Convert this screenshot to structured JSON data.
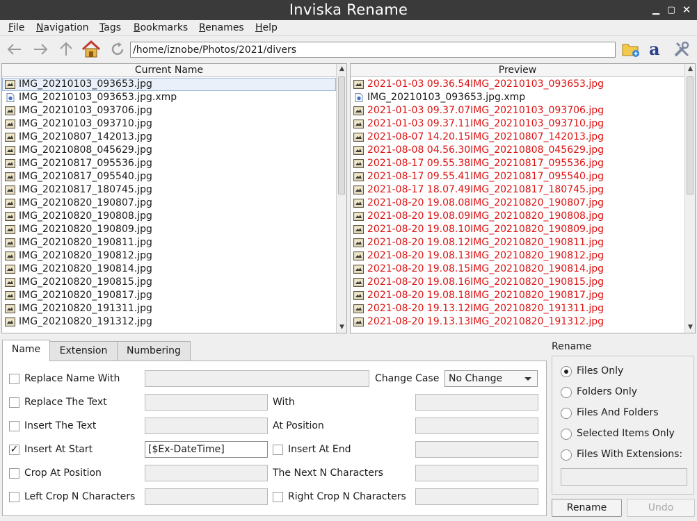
{
  "window": {
    "title": "Inviska Rename"
  },
  "menu": [
    "File",
    "Navigation",
    "Tags",
    "Bookmarks",
    "Renames",
    "Help"
  ],
  "toolbar": {
    "path": "/home/iznobe/Photos/2021/divers"
  },
  "current": {
    "header": "Current Name",
    "rows": [
      "IMG_20210103_093653.jpg",
      "IMG_20210103_093653.jpg.xmp",
      "IMG_20210103_093706.jpg",
      "IMG_20210103_093710.jpg",
      "IMG_20210807_142013.jpg",
      "IMG_20210808_045629.jpg",
      "IMG_20210817_095536.jpg",
      "IMG_20210817_095540.jpg",
      "IMG_20210817_180745.jpg",
      "IMG_20210820_190807.jpg",
      "IMG_20210820_190808.jpg",
      "IMG_20210820_190809.jpg",
      "IMG_20210820_190811.jpg",
      "IMG_20210820_190812.jpg",
      "IMG_20210820_190814.jpg",
      "IMG_20210820_190815.jpg",
      "IMG_20210820_190817.jpg",
      "IMG_20210820_191311.jpg",
      "IMG_20210820_191312.jpg"
    ]
  },
  "preview": {
    "header": "Preview",
    "rows": [
      "2021-01-03 09.36.54IMG_20210103_093653.jpg",
      "IMG_20210103_093653.jpg.xmp",
      "2021-01-03 09.37.07IMG_20210103_093706.jpg",
      "2021-01-03 09.37.11IMG_20210103_093710.jpg",
      "2021-08-07 14.20.15IMG_20210807_142013.jpg",
      "2021-08-08 04.56.30IMG_20210808_045629.jpg",
      "2021-08-17 09.55.38IMG_20210817_095536.jpg",
      "2021-08-17 09.55.41IMG_20210817_095540.jpg",
      "2021-08-17 18.07.49IMG_20210817_180745.jpg",
      "2021-08-20 19.08.08IMG_20210820_190807.jpg",
      "2021-08-20 19.08.09IMG_20210820_190808.jpg",
      "2021-08-20 19.08.10IMG_20210820_190809.jpg",
      "2021-08-20 19.08.12IMG_20210820_190811.jpg",
      "2021-08-20 19.08.13IMG_20210820_190812.jpg",
      "2021-08-20 19.08.15IMG_20210820_190814.jpg",
      "2021-08-20 19.08.16IMG_20210820_190815.jpg",
      "2021-08-20 19.08.18IMG_20210820_190817.jpg",
      "2021-08-20 19.13.12IMG_20210820_191311.jpg",
      "2021-08-20 19.13.13IMG_20210820_191312.jpg"
    ]
  },
  "tabs": [
    "Name",
    "Extension",
    "Numbering"
  ],
  "form": {
    "replace_name_with": "Replace Name With",
    "change_case": "Change Case",
    "change_case_value": "No Change",
    "replace_the_text": "Replace The Text",
    "with": "With",
    "insert_the_text": "Insert The Text",
    "at_position": "At Position",
    "insert_at_start": "Insert At Start",
    "insert_at_start_value": "[$Ex-DateTime]",
    "insert_at_end": "Insert At End",
    "crop_at_position": "Crop At Position",
    "next_n_characters": "The Next N Characters",
    "left_crop": "Left Crop N Characters",
    "right_crop": "Right Crop N Characters",
    "checkmark": "✓"
  },
  "rename_panel": {
    "title": "Rename",
    "options": [
      "Files Only",
      "Folders Only",
      "Files And Folders",
      "Selected Items Only",
      "Files With Extensions:"
    ],
    "rename_button": "Rename",
    "undo_button": "Undo"
  },
  "colors": {
    "changed": "#dd1111",
    "titlebar": "#3a3a3a"
  }
}
